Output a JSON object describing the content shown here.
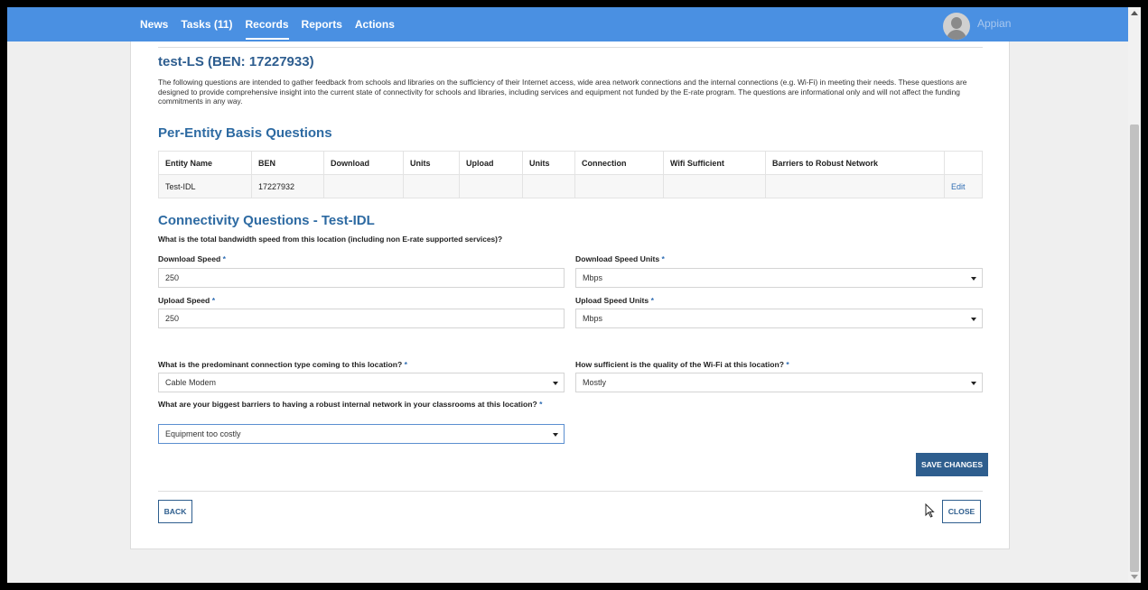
{
  "nav": {
    "items": [
      "News",
      "Tasks (11)",
      "Records",
      "Reports",
      "Actions"
    ],
    "active": "Records",
    "brand": "Appian"
  },
  "record": {
    "title": "test-LS (BEN: 17227933)",
    "intro": "The following questions are intended to gather feedback from schools and libraries on the sufficiency of their Internet access, wide area network connections and the internal connections (e.g. Wi-Fi) in meeting their needs. These questions are designed to provide comprehensive insight into the current state of connectivity for schools and libraries, including services and equipment not funded by the E-rate program. The questions are informational only and will not affect the funding commitments in any way."
  },
  "per_entity": {
    "heading": "Per-Entity Basis Questions",
    "columns": [
      "Entity Name",
      "BEN",
      "Download",
      "Units",
      "Upload",
      "Units",
      "Connection",
      "Wifi Sufficient",
      "Barriers to Robust Network",
      ""
    ],
    "rows": [
      {
        "entity_name": "Test-IDL",
        "ben": "17227932",
        "download": "",
        "download_units": "",
        "upload": "",
        "upload_units": "",
        "connection": "",
        "wifi": "",
        "barriers": "",
        "action": "Edit"
      }
    ]
  },
  "connectivity": {
    "heading": "Connectivity Questions - Test-IDL",
    "bandwidth_question": "What is the total bandwidth speed from this location (including non E-rate supported services)?",
    "download_speed_label": "Download Speed",
    "download_speed_value": "250",
    "download_units_label": "Download Speed Units",
    "download_units_value": "Mbps",
    "upload_speed_label": "Upload Speed",
    "upload_speed_value": "250",
    "upload_units_label": "Upload Speed Units",
    "upload_units_value": "Mbps",
    "connection_type_label": "What is the predominant connection type coming to this location?",
    "connection_type_value": "Cable Modem",
    "wifi_quality_label": "How sufficient is the quality of the Wi-Fi at this location?",
    "wifi_quality_value": "Mostly",
    "barriers_label": "What are your biggest barriers to having a robust internal network in your classrooms at this location?",
    "barriers_value": "Equipment too costly",
    "required_marker": "*"
  },
  "buttons": {
    "save": "SAVE CHANGES",
    "back": "BACK",
    "close": "CLOSE"
  },
  "colors": {
    "topbar": "#4a90e2",
    "heading": "#2d6aa2",
    "primary_button": "#2e5e8e"
  }
}
